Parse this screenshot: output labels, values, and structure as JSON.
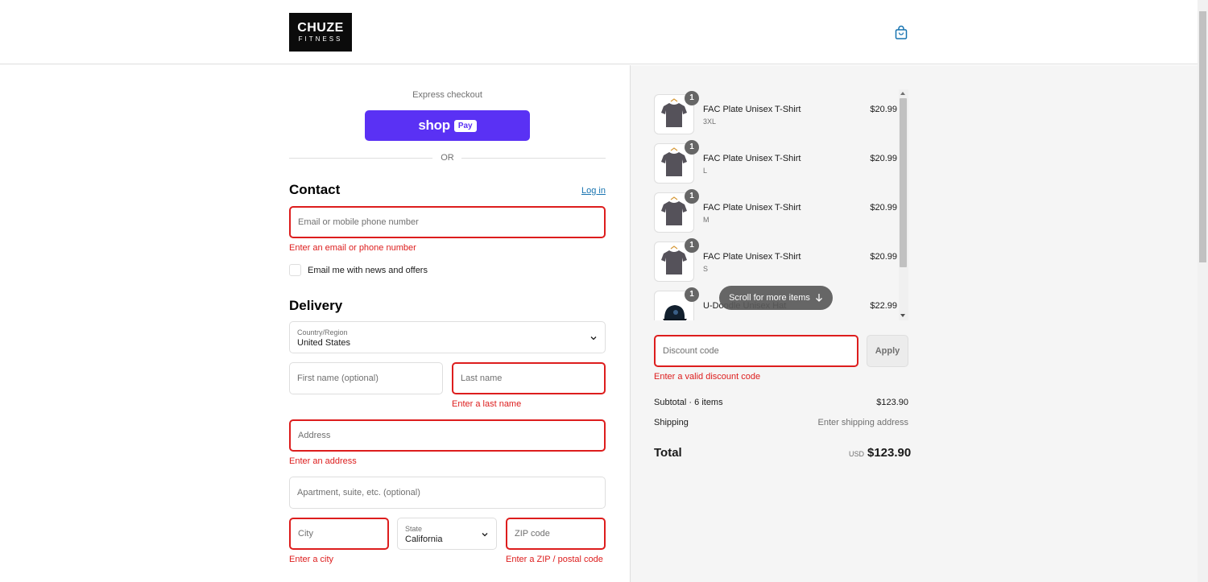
{
  "header": {
    "logo_line1": "CHUZE",
    "logo_line2": "FITNESS",
    "cart_icon": "shopping-bag-icon"
  },
  "express": {
    "label": "Express checkout",
    "shoppay_text": "shop",
    "shoppay_badge": "Pay",
    "or": "OR"
  },
  "contact": {
    "heading": "Contact",
    "login": "Log in",
    "email_placeholder": "Email or mobile phone number",
    "email_error": "Enter an email or phone number",
    "news_label": "Email me with news and offers"
  },
  "delivery": {
    "heading": "Delivery",
    "country_label": "Country/Region",
    "country_value": "United States",
    "first_name_placeholder": "First name (optional)",
    "last_name_placeholder": "Last name",
    "last_name_error": "Enter a last name",
    "address_placeholder": "Address",
    "address_error": "Enter an address",
    "apartment_placeholder": "Apartment, suite, etc. (optional)",
    "city_placeholder": "City",
    "city_error": "Enter a city",
    "state_label": "State",
    "state_value": "California",
    "zip_placeholder": "ZIP code",
    "zip_error": "Enter a ZIP / postal code"
  },
  "cart": {
    "items": [
      {
        "qty": "1",
        "name": "FAC Plate Unisex T-Shirt",
        "variant": "3XL",
        "price": "$20.99"
      },
      {
        "qty": "1",
        "name": "FAC Plate Unisex T-Shirt",
        "variant": "L",
        "price": "$20.99"
      },
      {
        "qty": "1",
        "name": "FAC Plate Unisex T-Shirt",
        "variant": "M",
        "price": "$20.99"
      },
      {
        "qty": "1",
        "name": "FAC Plate Unisex T-Shirt",
        "variant": "S",
        "price": "$20.99"
      },
      {
        "qty": "1",
        "name": "U-Doodle Unisex Hat",
        "variant": "",
        "price": "$22.99"
      }
    ],
    "scroll_hint": "Scroll for more items",
    "discount_placeholder": "Discount code",
    "discount_error": "Enter a valid discount code",
    "apply": "Apply"
  },
  "summary": {
    "subtotal_label": "Subtotal · 6 items",
    "subtotal_value": "$123.90",
    "shipping_label": "Shipping",
    "shipping_value": "Enter shipping address",
    "total_label": "Total",
    "total_currency": "USD",
    "total_value": "$123.90"
  },
  "colors": {
    "accent": "#5a31f4",
    "error": "#dd1d1d",
    "link": "#1773b0"
  }
}
